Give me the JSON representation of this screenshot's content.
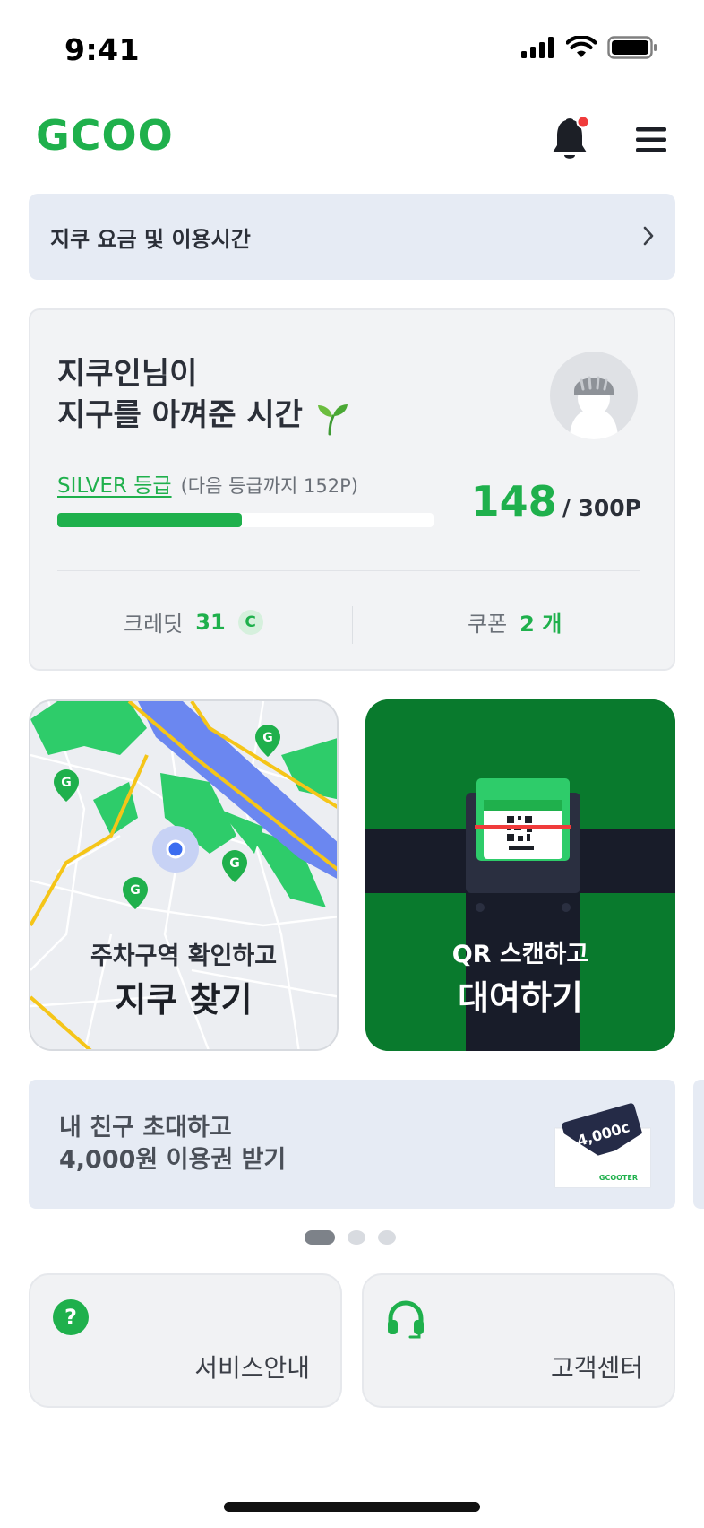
{
  "status_bar": {
    "time": "9:41"
  },
  "header": {
    "logo": "GCOO",
    "notification_dot": true,
    "brand_color": "#1fb04c"
  },
  "fee_banner": {
    "label": "지쿠 요금 및 이용시간"
  },
  "profile": {
    "greeting_line1": "지쿠인님이",
    "greeting_line2": "지구를 아껴준 시간",
    "grade": "SILVER 등급",
    "grade_note": "(다음 등급까지 152P)",
    "points_current": "148",
    "points_max": "/ 300P",
    "progress": 0.49,
    "credit_label": "크레딧",
    "credit_value": "31",
    "credit_badge": "C",
    "coupon_label": "쿠폰",
    "coupon_value": "2 개"
  },
  "tiles": {
    "map": {
      "subtitle": "주차구역 확인하고",
      "title": "지쿠 찾기"
    },
    "qr": {
      "subtitle": "QR 스캔하고",
      "title": "대여하기"
    }
  },
  "invite_banner": {
    "line1": "내 친구 초대하고",
    "line2": "4,000원 이용권 받기",
    "voucher_amount": "4,000c",
    "voucher_brand": "GCOOTER"
  },
  "carousel": {
    "pages": 3,
    "active": 0
  },
  "quick_menu": {
    "service_label": "서비스안내",
    "support_label": "고객센터"
  }
}
